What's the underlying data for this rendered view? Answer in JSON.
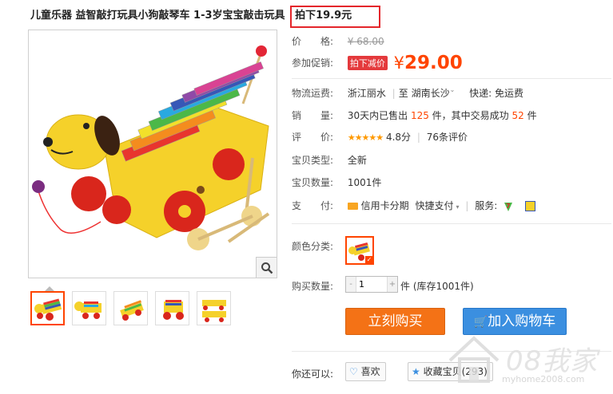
{
  "title": {
    "text": "儿童乐器 益智敲打玩具小狗敲琴车 1-3岁宝宝敲击玩具",
    "highlight": "拍下19.9元"
  },
  "price": {
    "label": "价　　格:",
    "value": "¥ 68.00"
  },
  "promo": {
    "label": "参加促销:",
    "badge": "拍下减价",
    "yen": "¥",
    "amount": "29.00"
  },
  "shipping": {
    "label": "物流运费:",
    "from": "浙江丽水",
    "to_prefix": "至",
    "to": "湖南长沙",
    "method": "快递: 免运费"
  },
  "sales": {
    "label": "销　　量:",
    "prefix": "30天内已售出",
    "count": "125",
    "unit1": "件，其中交易成功",
    "success": "52",
    "unit2": "件"
  },
  "rating": {
    "label": "评　　价:",
    "stars": "★★★★★",
    "score": "4.8分",
    "reviews": "76条评价"
  },
  "type": {
    "label": "宝贝类型:",
    "value": "全新"
  },
  "stock": {
    "label": "宝贝数量:",
    "value": "1001件"
  },
  "payment": {
    "label": "支　　付:",
    "installment": "信用卡分期",
    "quick": "快捷支付",
    "service": "服务:"
  },
  "color_option": {
    "label": "颜色分类:"
  },
  "quantity": {
    "label": "购买数量:",
    "value": "1",
    "minus": "-",
    "plus": "+",
    "stock_text": "件 (库存1001件)"
  },
  "buttons": {
    "buy": "立刻购买",
    "cart": "加入购物车"
  },
  "also": {
    "label": "你还可以:",
    "like": "喜欢",
    "favorite": "收藏宝贝(293)"
  },
  "watermark": {
    "text": "08我家",
    "url": "myhome2008.com"
  },
  "colors": {
    "accent": "#ff4400",
    "buy_button": "#f47216",
    "cart_button": "#3b8fe0",
    "highlight_border": "#e4262b"
  }
}
